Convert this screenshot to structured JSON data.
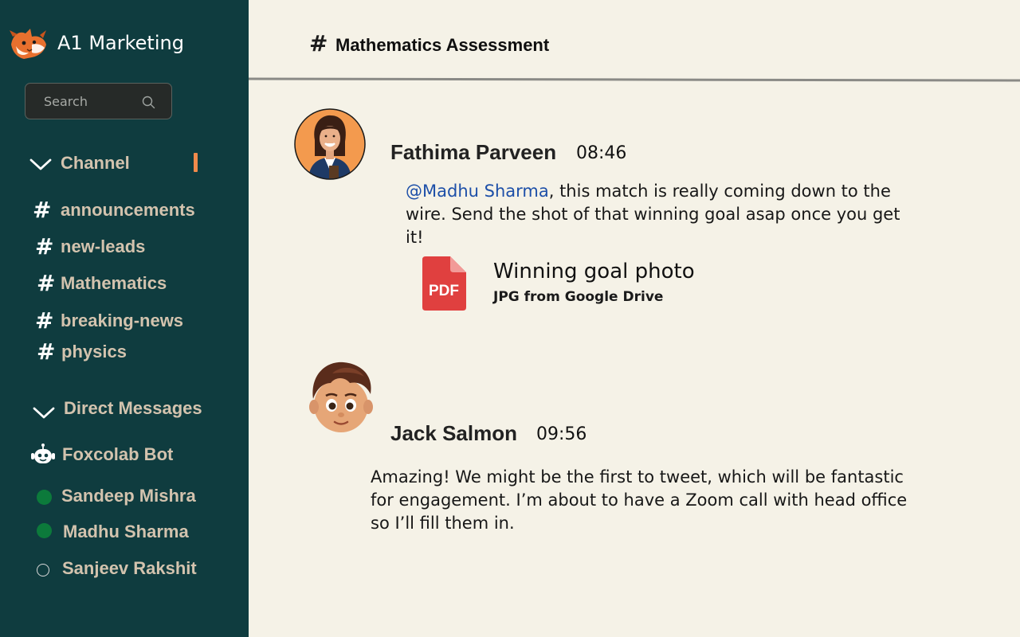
{
  "workspace": {
    "name": "A1 Marketing",
    "logo_icon": "fox-logo-icon"
  },
  "search": {
    "placeholder": "Search"
  },
  "sidebar": {
    "channels_header": "Channel",
    "channels": [
      {
        "label": "announcements"
      },
      {
        "label": "new-leads"
      },
      {
        "label": "Mathematics"
      },
      {
        "label": "breaking-news"
      },
      {
        "label": "physics"
      }
    ],
    "dm_header": "Direct Messages",
    "direct_messages": [
      {
        "label": "Foxcolab Bot",
        "status": "bot"
      },
      {
        "label": "Sandeep Mishra",
        "status": "online"
      },
      {
        "label": "Madhu Sharma",
        "status": "online"
      },
      {
        "label": "Sanjeev Rakshit",
        "status": "offline"
      }
    ],
    "colors": {
      "background": "#0f3c3f",
      "label": "#d3c3ae",
      "accent": "#f08a4b",
      "online": "#0c7a3b"
    }
  },
  "header": {
    "hash": "#",
    "title": "Mathematics Assessment"
  },
  "messages": [
    {
      "author": "Fathima Parveen",
      "time": "08:46",
      "mention": "@Madhu Sharma",
      "text": ", this match is really coming down to the wire. Send the shot of that winning goal asap once you get it!",
      "attachment": {
        "badge": "PDF",
        "title": "Winning goal photo",
        "subtitle": "JPG from Google Drive"
      }
    },
    {
      "author": "Jack Salmon",
      "time": "09:56",
      "text": "Amazing! We might be the first to tweet, which will be fantastic for engagement. I’m about to have a Zoom call with head office so I’ll fill them in."
    }
  ]
}
